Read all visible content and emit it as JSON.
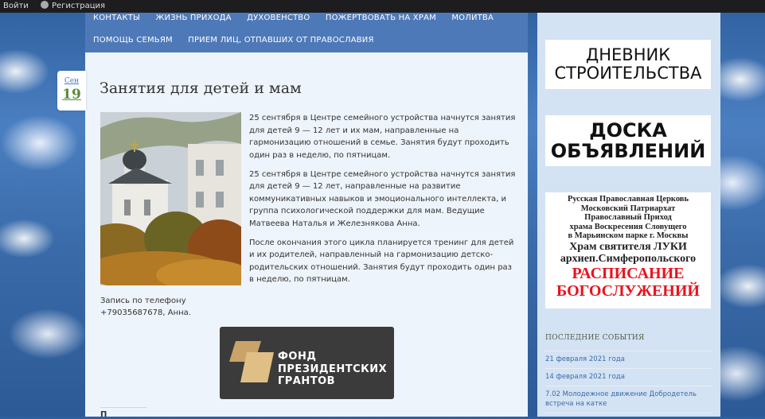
{
  "topbar": {
    "login": "Войти",
    "register": "Регистрация"
  },
  "nav": {
    "row1": [
      "КОНТАКТЫ",
      "ЖИЗНЬ ПРИХОДА",
      "ДУХОВЕНСТВО",
      "ПОЖЕРТВОВАТЬ НА ХРАМ",
      "МОЛИТВА"
    ],
    "row2": [
      "ПОМОЩЬ СЕМЬЯМ",
      "ПРИЕМ ЛИЦ, ОТПАВШИХ ОТ ПРАВОСЛАВИЯ"
    ]
  },
  "post": {
    "month": "Сен",
    "day": "19",
    "title": "Занятия для детей и мам",
    "paragraphs": [
      "25 сентября в Центре семейного устройства начнутся занятия для детей 9 — 12 лет и их мам, направленные на гармонизацию отношений в семье. Занятия будут проходить один раз в неделю, по пятницам.",
      "25 сентября в Центре семейного устройства начнутся занятия для детей 9 — 12 лет, направленные на развитие коммуникативных навыков и эмоционального интеллекта, и группа психологической поддержки для мам. Ведущие Матвеева Наталья и Железнякова Анна.",
      "После окончания этого цикла планируется тренинг для детей и их родителей, направленный на гармонизацию детско-родительских отношений. Занятия будут проходить один раз в неделю, по пятницам."
    ],
    "contact_line1": "Запись по телефону",
    "contact_line2": "+79035687678, Анна.",
    "grant_logo_lines": [
      "ФОНД",
      "ПРЕЗИДЕНТСКИХ",
      "ГРАНТОВ"
    ],
    "bottom_cut_text": "П"
  },
  "sidebar": {
    "diary": [
      "ДНЕВНИК",
      "СТРОИТЕЛЬСТВА"
    ],
    "board": [
      "ДОСКА",
      "ОБЪЯВЛЕНИЙ"
    ],
    "schedule_small": [
      "Русская Православная Церковь",
      "Московский Патриархат",
      "Православный Приход",
      "храма Воскресения Словущего",
      "в Марьинском парке  г. Москвы"
    ],
    "schedule_mid": [
      "Храм святителя ЛУКИ",
      "архиеп.Симферопольского"
    ],
    "schedule_red": [
      "РАСПИСАНИЕ",
      "БОГОСЛУЖЕНИЙ"
    ],
    "events_title": "ПОСЛЕДНИЕ СОБЫТИЯ",
    "events": [
      "21 февраля 2021 года",
      "14 февраля 2021 года",
      "7.02 Молодежное движение Добродетель встреча на катке"
    ]
  },
  "colors": {
    "nav_bg": "#4e79b8",
    "link": "#3c6aa8",
    "schedule_red": "#e8131e",
    "date_day": "#5b8a3a"
  }
}
